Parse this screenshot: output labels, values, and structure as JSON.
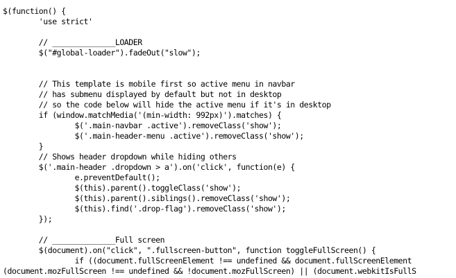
{
  "editor": {
    "lines": [
      "$(function() {",
      "        'use strict'",
      "",
      "        // ______________LOADER",
      "        $(\"#global-loader\").fadeOut(\"slow\");",
      "",
      "",
      "        // This template is mobile first so active menu in navbar",
      "        // has submenu displayed by default but not in desktop",
      "        // so the code below will hide the active menu if it's in desktop",
      "        if (window.matchMedia('(min-width: 992px)').matches) {",
      "                $('.main-navbar .active').removeClass('show');",
      "                $('.main-header-menu .active').removeClass('show');",
      "        }",
      "        // Shows header dropdown while hiding others",
      "        $('.main-header .dropdown > a').on('click', function(e) {",
      "                e.preventDefault();",
      "                $(this).parent().toggleClass('show');",
      "                $(this).parent().siblings().removeClass('show');",
      "                $(this).find('.drop-flag').removeClass('show');",
      "        });",
      "",
      "        // ______________Full screen",
      "        $(document).on(\"click\", \".fullscreen-button\", function toggleFullScreen() {",
      "                if ((document.fullScreenElement !== undefined && document.fullScreenElement",
      "(document.mozFullScreen !== undefined && !document.mozFullScreen) || (document.webkitIsFullS"
    ]
  }
}
